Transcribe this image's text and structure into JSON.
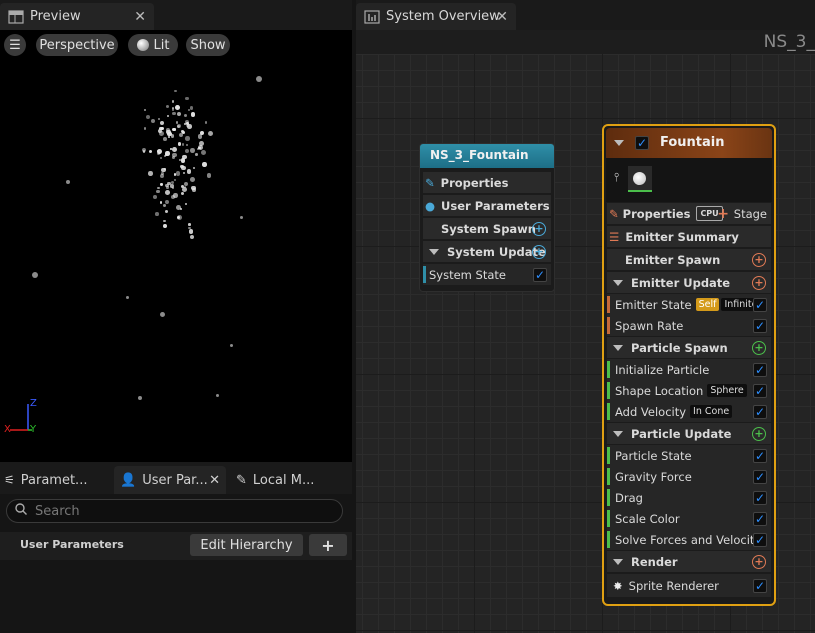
{
  "preview_panel": {
    "tab_title": "Preview",
    "toolbar": {
      "perspective": "Perspective",
      "lit": "Lit",
      "show": "Show"
    },
    "axes": {
      "x": "X",
      "y": "Y",
      "z": "Z"
    }
  },
  "lower_panel": {
    "tabs": [
      "Paramet...",
      "User Par...",
      "Local M..."
    ],
    "search_placeholder": "Search",
    "section_label": "User Parameters",
    "edit_hierarchy": "Edit Hierarchy",
    "add_symbol": "+"
  },
  "graph": {
    "tab_title": "System Overview",
    "asset_label": "NS_3_",
    "system_node": {
      "title": "NS_3_Fountain",
      "rows": {
        "properties": "Properties",
        "user_parameters": "User Parameters",
        "system_spawn": "System Spawn",
        "system_update": "System Update",
        "system_state": "System State"
      }
    },
    "emitter_node": {
      "title": "Fountain",
      "properties": "Properties",
      "cpu_badge": "CPU",
      "stage": "Stage",
      "emitter_summary": "Emitter Summary",
      "emitter_spawn": "Emitter Spawn",
      "emitter_update": "Emitter Update",
      "emitter_state": "Emitter State",
      "self_tag": "Self",
      "infinite_tag": "Infinite",
      "spawn_rate": "Spawn Rate",
      "particle_spawn": "Particle Spawn",
      "initialize_particle": "Initialize Particle",
      "shape_location": "Shape Location",
      "sphere_tag": "Sphere",
      "add_velocity": "Add Velocity",
      "in_cone_tag": "In Cone",
      "particle_update": "Particle Update",
      "particle_state": "Particle State",
      "gravity_force": "Gravity Force",
      "drag": "Drag",
      "scale_color": "Scale Color",
      "solve_forces": "Solve Forces and Velocity",
      "render": "Render",
      "sprite_renderer": "Sprite Renderer"
    }
  },
  "colors": {
    "system_node_header": "#1d6e86",
    "emitter_node_header": "#7a3a14",
    "selection_outline": "#e0a012",
    "spawn_plus": "#e07a55",
    "update_plus": "#4bbf4b",
    "checkbox_check": "#2d8fff"
  },
  "icons": [
    "grid-layout-icon",
    "close-icon",
    "hamburger-icon",
    "sphere-icon",
    "graph-icon",
    "sliders-icon",
    "user-icon",
    "pencil-icon",
    "list-icon",
    "plus-circle-icon",
    "checkbox-icon",
    "triangle-down-icon",
    "search-icon",
    "sparkle-icon",
    "stage-plus-icon"
  ]
}
